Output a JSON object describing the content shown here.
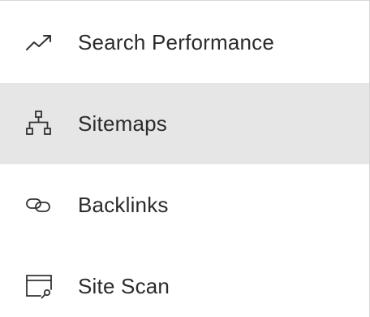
{
  "menu": {
    "items": [
      {
        "label": "Search Performance",
        "icon": "trending-up-icon",
        "selected": false
      },
      {
        "label": "Sitemaps",
        "icon": "sitemap-icon",
        "selected": true
      },
      {
        "label": "Backlinks",
        "icon": "link-icon",
        "selected": false
      },
      {
        "label": "Site Scan",
        "icon": "site-scan-icon",
        "selected": false
      }
    ]
  },
  "colors": {
    "text": "#2b2b2b",
    "icon": "#333333",
    "selected_background": "#e6e6e6",
    "border": "#d6d6d6"
  }
}
